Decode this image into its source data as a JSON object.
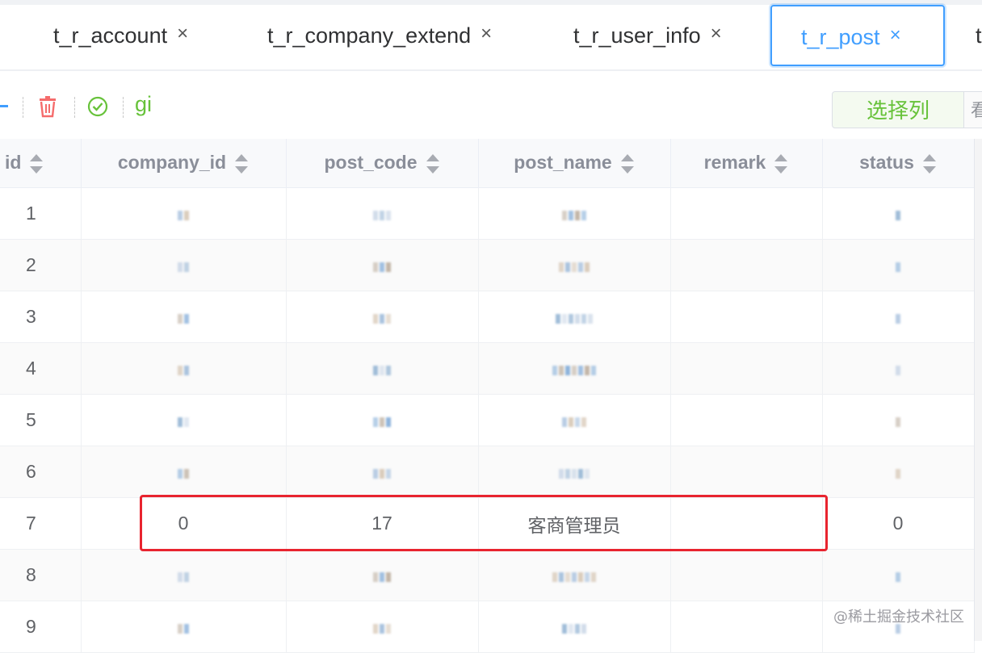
{
  "tabs": [
    {
      "label": "t_r_account",
      "close": "×"
    },
    {
      "label": "t_r_company_extend",
      "close": "×"
    },
    {
      "label": "t_r_user_info",
      "close": "×"
    },
    {
      "label": "t_r_post",
      "close": "×",
      "active": true
    },
    {
      "label": "t",
      "close": ""
    }
  ],
  "toolbar": {
    "gi_label": "gi",
    "select_columns_label": "选择列",
    "select_columns_extra": "看"
  },
  "table": {
    "columns": [
      "id",
      "company_id",
      "post_code",
      "post_name",
      "remark",
      "status"
    ],
    "rows": [
      {
        "id": "1",
        "company_id": "",
        "post_code": "",
        "post_name": "",
        "remark": "",
        "status": ""
      },
      {
        "id": "2",
        "company_id": "",
        "post_code": "",
        "post_name": "",
        "remark": "",
        "status": ""
      },
      {
        "id": "3",
        "company_id": "",
        "post_code": "",
        "post_name": "",
        "remark": "",
        "status": ""
      },
      {
        "id": "4",
        "company_id": "",
        "post_code": "",
        "post_name": "",
        "remark": "",
        "status": ""
      },
      {
        "id": "5",
        "company_id": "",
        "post_code": "",
        "post_name": "",
        "remark": "",
        "status": ""
      },
      {
        "id": "6",
        "company_id": "",
        "post_code": "",
        "post_name": "",
        "remark": "",
        "status": ""
      },
      {
        "id": "7",
        "company_id": "0",
        "post_code": "17",
        "post_name": "客商管理员",
        "remark": "",
        "status": "0"
      },
      {
        "id": "8",
        "company_id": "",
        "post_code": "",
        "post_name": "",
        "remark": "",
        "status": ""
      },
      {
        "id": "9",
        "company_id": "",
        "post_code": "",
        "post_name": "",
        "remark": "",
        "status": ""
      }
    ]
  },
  "watermark": "@稀土掘金技术社区",
  "colors": {
    "accent": "#409eff",
    "success": "#67c23a",
    "danger": "#f56c6c",
    "highlight_border": "#e8242f"
  },
  "icons": {
    "delete": "trash-icon",
    "confirm": "check-circle-icon",
    "sort": "sort-caret-icon"
  }
}
